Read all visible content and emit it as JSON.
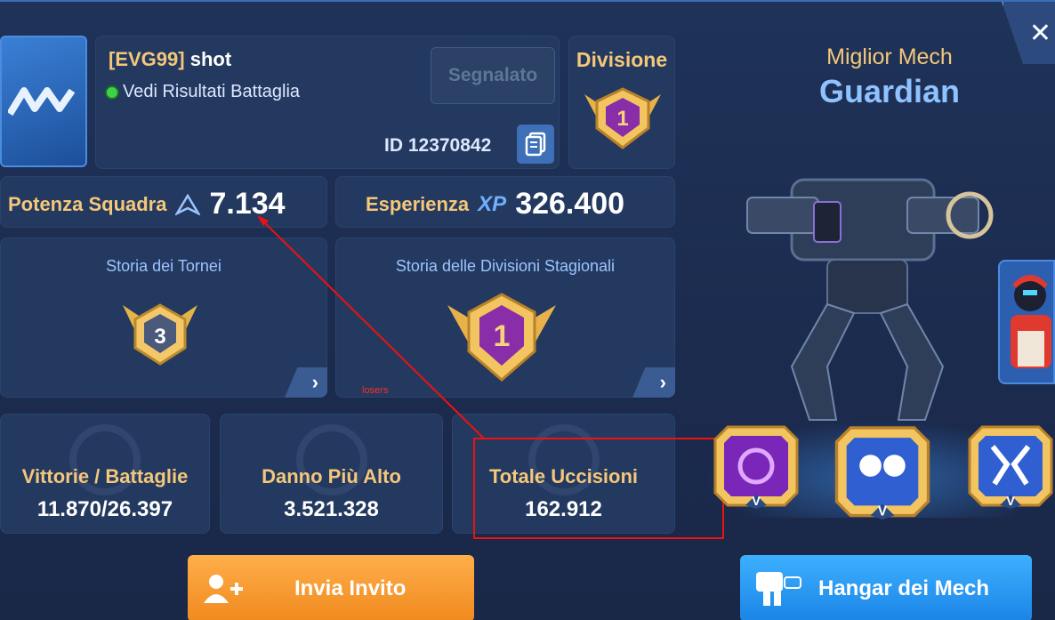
{
  "player": {
    "tag": "[EVG99]",
    "name": "shot",
    "status": "Vedi Risultati Battaglia",
    "report_label": "Segnalato",
    "id_text": "ID 12370842"
  },
  "division": {
    "title": "Divisione",
    "rank": "1"
  },
  "power": {
    "label": "Potenza Squadra",
    "value": "7.134"
  },
  "experience": {
    "label": "Esperienza",
    "badge": "XP",
    "value": "326.400"
  },
  "history": {
    "tournaments": {
      "title": "Storia dei Tornei",
      "rank": "3"
    },
    "seasonal": {
      "title": "Storia delle Divisioni Stagionali",
      "rank": "1",
      "annotation": "losers"
    }
  },
  "stats": [
    {
      "label": "Vittorie / Battaglie",
      "value": "11.870/26.397"
    },
    {
      "label": "Danno Più Alto",
      "value": "3.521.328"
    },
    {
      "label": "Totale Uccisioni",
      "value": "162.912"
    }
  ],
  "best_mech": {
    "label": "Miglior Mech",
    "name": "Guardian"
  },
  "module_grade": "V",
  "buttons": {
    "invite": "Invia Invito",
    "hangar": "Hangar dei Mech"
  },
  "colors": {
    "gold": "#f4c77a",
    "accent_blue": "#8fc3ff",
    "orange": "#f08a1e",
    "blue_button": "#1b84e6",
    "annotation_red": "#e11111"
  }
}
